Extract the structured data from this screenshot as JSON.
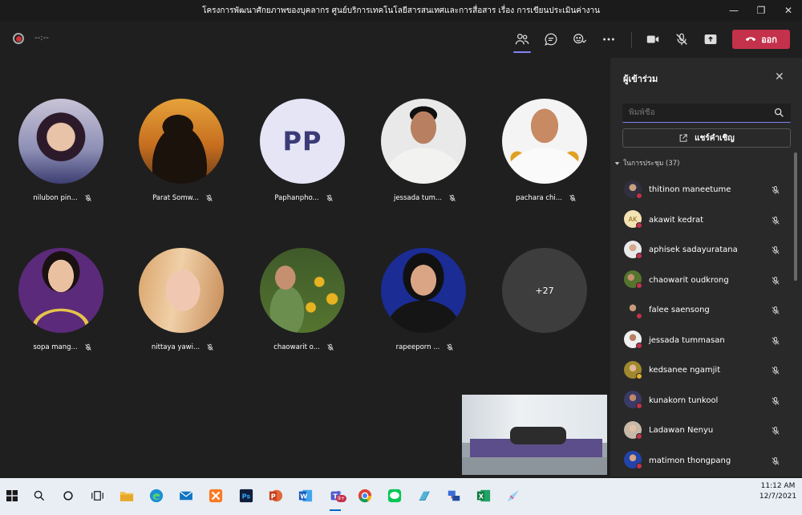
{
  "window": {
    "title": "โครงการพัฒนาศักยภาพของบุคลากร ศูนย์บริการเทคโนโลยีสารสนเทศและการสื่อสาร เรื่อง การเขียนประเมินค่างาน"
  },
  "toolbar": {
    "timer": "--:--",
    "leave_label": "ออก"
  },
  "participants_grid": [
    {
      "name": "nilubon pin..."
    },
    {
      "name": "Parat Somw..."
    },
    {
      "name": "Paphanpho...",
      "initials": "PP"
    },
    {
      "name": "jessada tum..."
    },
    {
      "name": "pachara chi..."
    },
    {
      "name": "sopa mang..."
    },
    {
      "name": "nittaya yawi..."
    },
    {
      "name": "chaowarit o..."
    },
    {
      "name": "rapeeporn ..."
    }
  ],
  "overflow_tile": {
    "label": "+27"
  },
  "panel": {
    "title": "ผู้เข้าร่วม",
    "search_placeholder": "พิมพ์ชื่อ",
    "share_invite_label": "แชร์คำเชิญ",
    "section_label": "ในการประชุม (37)",
    "participants": [
      {
        "name": "thitinon maneetume"
      },
      {
        "name": "akawit kedrat",
        "initials": "AK"
      },
      {
        "name": "aphisek sadayuratana"
      },
      {
        "name": "chaowarit oudkrong"
      },
      {
        "name": "falee saensong"
      },
      {
        "name": "jessada tummasan"
      },
      {
        "name": "kedsanee ngamjit"
      },
      {
        "name": "kunakorn tunkool"
      },
      {
        "name": "Ladawan Nenyu"
      },
      {
        "name": "matimon thongpang"
      }
    ]
  },
  "taskbar": {
    "time": "11:12 AM",
    "date": "12/7/2021",
    "teams_badge": "9+"
  },
  "colors": {
    "accent": "#7f85f5",
    "leave": "#c4314b",
    "panel_bg": "#292929",
    "stage_bg": "#1f1f1f"
  }
}
